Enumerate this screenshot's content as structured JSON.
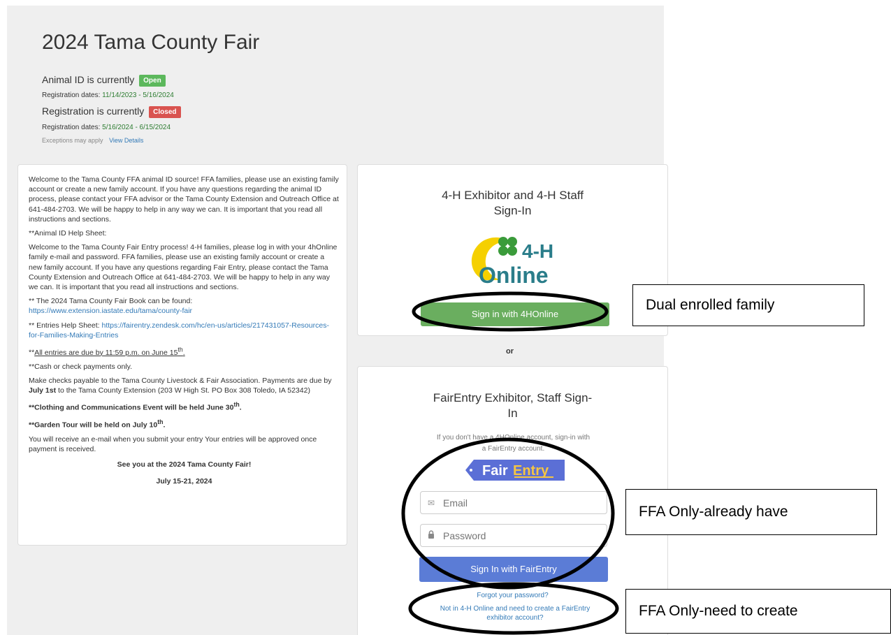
{
  "header": {
    "title": "2024 Tama County Fair",
    "animal_id_text": "Animal ID is currently",
    "animal_id_status": "Open",
    "animal_id_dates_label": "Registration dates:",
    "animal_id_dates": "11/14/2023 - 5/16/2024",
    "registration_text": "Registration is currently",
    "registration_status": "Closed",
    "registration_dates_label": "Registration dates:",
    "registration_dates": "5/16/2024 - 6/15/2024",
    "exceptions_text": "Exceptions may apply",
    "view_details_link": "View Details"
  },
  "info": {
    "p1": "Welcome to the Tama County FFA animal ID source! FFA families, please use an existing family account or create a new family account. If you have any questions regarding the animal ID process, please contact your FFA advisor or the Tama County Extension and Outreach Office at 641-484-2703. We will be happy to help in any way we can. It is important that you read all instructions and sections.",
    "p2": "**Animal ID Help Sheet:",
    "p3": "Welcome to the Tama County Fair Entry process! 4-H families, please log in with your 4hOnline family e-mail and password. FFA families, please use an existing family account or create a new family account. If you have any questions regarding Fair Entry, please contact the Tama County Extension and Outreach Office at 641-484-2703. We will be happy to help in any way we can. It is important that you read all instructions and sections.",
    "fairbook_text": "** The 2024 Tama County Fair Book can be found:",
    "fairbook_link": "https://www.extension.iastate.edu/tama/county-fair",
    "entries_help_text": "** Entries Help Sheet:",
    "entries_help_link": "https://fairentry.zendesk.com/hc/en-us/articles/217431057-Resources-for-Families-Making-Entries",
    "due_prefix": "**",
    "due_text": "All entries are due by 11:59 p.m. on June 15",
    "due_sup": "th",
    "due_end": ".",
    "cash_text": "**Cash or check payments only.",
    "checks_a": "Make checks payable to the Tama County Livestock & Fair Association. Payments are due by",
    "checks_bold": "July 1st",
    "checks_b": "to the Tama County Extension (203 W High St. PO Box 308 Toledo, IA 52342)",
    "clothing_text": "**Clothing and Communications Event will be held June 30",
    "clothing_sup": "th",
    "clothing_end": ".",
    "garden_text": "**Garden Tour will be held on July 10",
    "garden_sup": "th",
    "garden_end": ".",
    "email_text": "You will receive an e-mail when you submit your entry Your entries will be approved once payment is received.",
    "see_you": "See you at the 2024 Tama County Fair!",
    "fair_dates": "July 15-21, 2024"
  },
  "signin_4h": {
    "title_line1": "4-H Exhibitor and 4-H Staff",
    "title_line2": "Sign-In",
    "logo_top": "4-H",
    "logo_bottom": "Online",
    "button": "Sign in with 4HOnline"
  },
  "or_text": "or",
  "signin_fe": {
    "title_line1": "FairEntry Exhibitor, Staff Sign-",
    "title_line2": "In",
    "hint_line1": "If you don't have a 4HOnline account, sign-in with",
    "hint_line2": "a FairEntry account.",
    "logo_fair": "Fair",
    "logo_entry": "Entry",
    "email_placeholder": "Email",
    "password_placeholder": "Password",
    "button": "Sign In with FairEntry",
    "forgot_link": "Forgot your password?",
    "create_link": "Not in 4-H Online and need to create a FairEntry exhibitor account?"
  },
  "annotations": {
    "dual": "Dual enrolled family",
    "ffa_have": "FFA Only-already have",
    "ffa_create": "FFA Only-need to create"
  },
  "colors": {
    "open_badge": "#5cb85c",
    "closed_badge": "#d9534f",
    "btn_4h": "#6aae5f",
    "btn_fairentry": "#5b7cd6",
    "link": "#337ab7"
  }
}
